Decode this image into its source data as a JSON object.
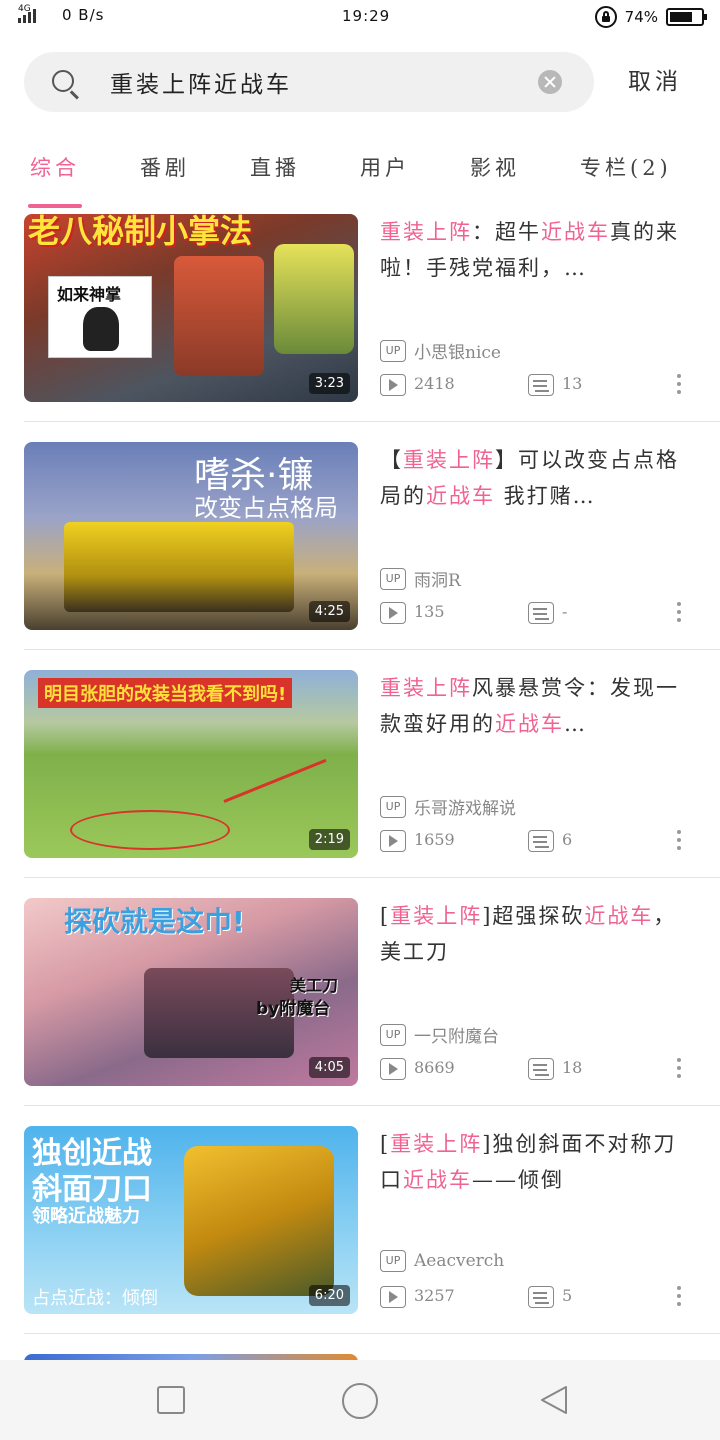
{
  "status_bar": {
    "network": "4G",
    "speed": "0 B/s",
    "time": "19:29",
    "battery": "74%",
    "battery_level": 0.74
  },
  "search": {
    "query": "重装上阵近战车",
    "cancel_label": "取消"
  },
  "tabs": [
    {
      "label": "综合",
      "active": true
    },
    {
      "label": "番剧",
      "active": false
    },
    {
      "label": "直播",
      "active": false
    },
    {
      "label": "用户",
      "active": false
    },
    {
      "label": "影视",
      "active": false
    },
    {
      "label": "专栏(2)",
      "active": false
    }
  ],
  "results": [
    {
      "title_segments": [
        {
          "text": "重装上阵",
          "highlight": true
        },
        {
          "text": "：超牛",
          "highlight": false
        },
        {
          "text": "近战车",
          "highlight": true
        },
        {
          "text": "真的来啦！手残党福利，…",
          "highlight": false
        }
      ],
      "uploader": "小思银nice",
      "plays": "2418",
      "danmaku": "13",
      "duration": "3:23",
      "thumb_caption": "老八秘制小掌法",
      "thumb_sticker": "如来神掌"
    },
    {
      "title_segments": [
        {
          "text": "【",
          "highlight": false
        },
        {
          "text": "重装上阵",
          "highlight": true
        },
        {
          "text": "】可以改变占点格局的",
          "highlight": false
        },
        {
          "text": "近战车",
          "highlight": true
        },
        {
          "text": " 我打赌…",
          "highlight": false
        }
      ],
      "uploader": "雨洞R",
      "plays": "135",
      "danmaku": "-",
      "duration": "4:25",
      "thumb_caption": "嗜杀·镰",
      "thumb_sub": "改变占点格局"
    },
    {
      "title_segments": [
        {
          "text": "重装上阵",
          "highlight": true
        },
        {
          "text": "风暴悬赏令：发现一款蛮好用的",
          "highlight": false
        },
        {
          "text": "近战车",
          "highlight": true
        },
        {
          "text": "…",
          "highlight": false
        }
      ],
      "uploader": "乐哥游戏解说",
      "plays": "1659",
      "danmaku": "6",
      "duration": "2:19",
      "thumb_caption": "明目张胆的改装当我看不到吗!"
    },
    {
      "title_segments": [
        {
          "text": "[",
          "highlight": false
        },
        {
          "text": "重装上阵",
          "highlight": true
        },
        {
          "text": "]超强探砍",
          "highlight": false
        },
        {
          "text": "近战车",
          "highlight": true
        },
        {
          "text": "，美工刀",
          "highlight": false
        }
      ],
      "uploader": "一只附魔台",
      "plays": "8669",
      "danmaku": "18",
      "duration": "4:05",
      "thumb_caption": "探砍就是这巾!",
      "thumb_sub": "美工刀",
      "thumb_sub2": "by附魔台"
    },
    {
      "title_segments": [
        {
          "text": "[",
          "highlight": false
        },
        {
          "text": "重装上阵",
          "highlight": true
        },
        {
          "text": "]独创斜面不对称刀口",
          "highlight": false
        },
        {
          "text": "近战车",
          "highlight": true
        },
        {
          "text": "——倾倒",
          "highlight": false
        }
      ],
      "uploader": "Aeacverch",
      "plays": "3257",
      "danmaku": "5",
      "duration": "6:20",
      "thumb_caption": "独创近战",
      "thumb_caption2": "斜面刀口",
      "thumb_sub": "领略近战魅力",
      "thumb_sub2": "占点近战：倾倒"
    }
  ],
  "colors": {
    "accent": "#f06292",
    "text": "#333333",
    "muted": "#888888"
  }
}
